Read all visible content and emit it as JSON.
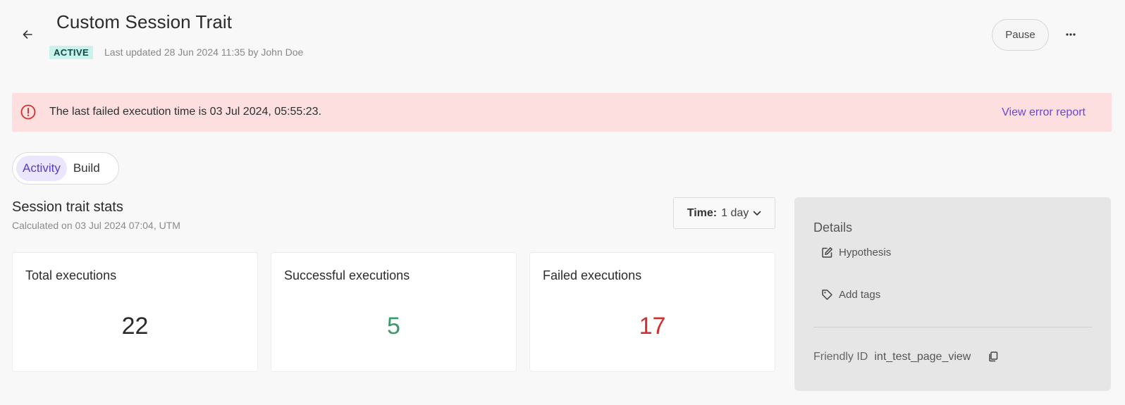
{
  "header": {
    "title": "Custom Session Trait",
    "status": "ACTIVE",
    "last_updated": "Last updated 28 Jun 2024 11:35 by John Doe",
    "pause_label": "Pause"
  },
  "banner": {
    "message": "The last failed execution time is 03 Jul 2024, 05:55:23.",
    "link": "View error report"
  },
  "tabs": [
    {
      "label": "Activity",
      "active": true
    },
    {
      "label": "Build",
      "active": false
    }
  ],
  "stats": {
    "title": "Session trait stats",
    "subtitle": "Calculated on 03 Jul 2024 07:04, UTM",
    "time_label": "Time:",
    "time_value": "1 day",
    "cards": [
      {
        "label": "Total executions",
        "value": "22"
      },
      {
        "label": "Successful executions",
        "value": "5"
      },
      {
        "label": "Failed executions",
        "value": "17"
      }
    ]
  },
  "details": {
    "title": "Details",
    "hypothesis": "Hypothesis",
    "add_tags": "Add tags",
    "friendly_id_label": "Friendly ID",
    "friendly_id_value": "int_test_page_view"
  },
  "colors": {
    "accent": "#5a3ad1",
    "success": "#3a9a6a",
    "error": "#d32f2f",
    "banner_bg": "#fddfe0"
  },
  "icons": {
    "back": "arrow-left-icon",
    "more": "more-horizontal-icon",
    "error": "alert-circle-icon",
    "chevron": "chevron-down-icon",
    "hypothesis": "edit-icon",
    "tags": "tag-icon",
    "copy": "copy-icon"
  }
}
